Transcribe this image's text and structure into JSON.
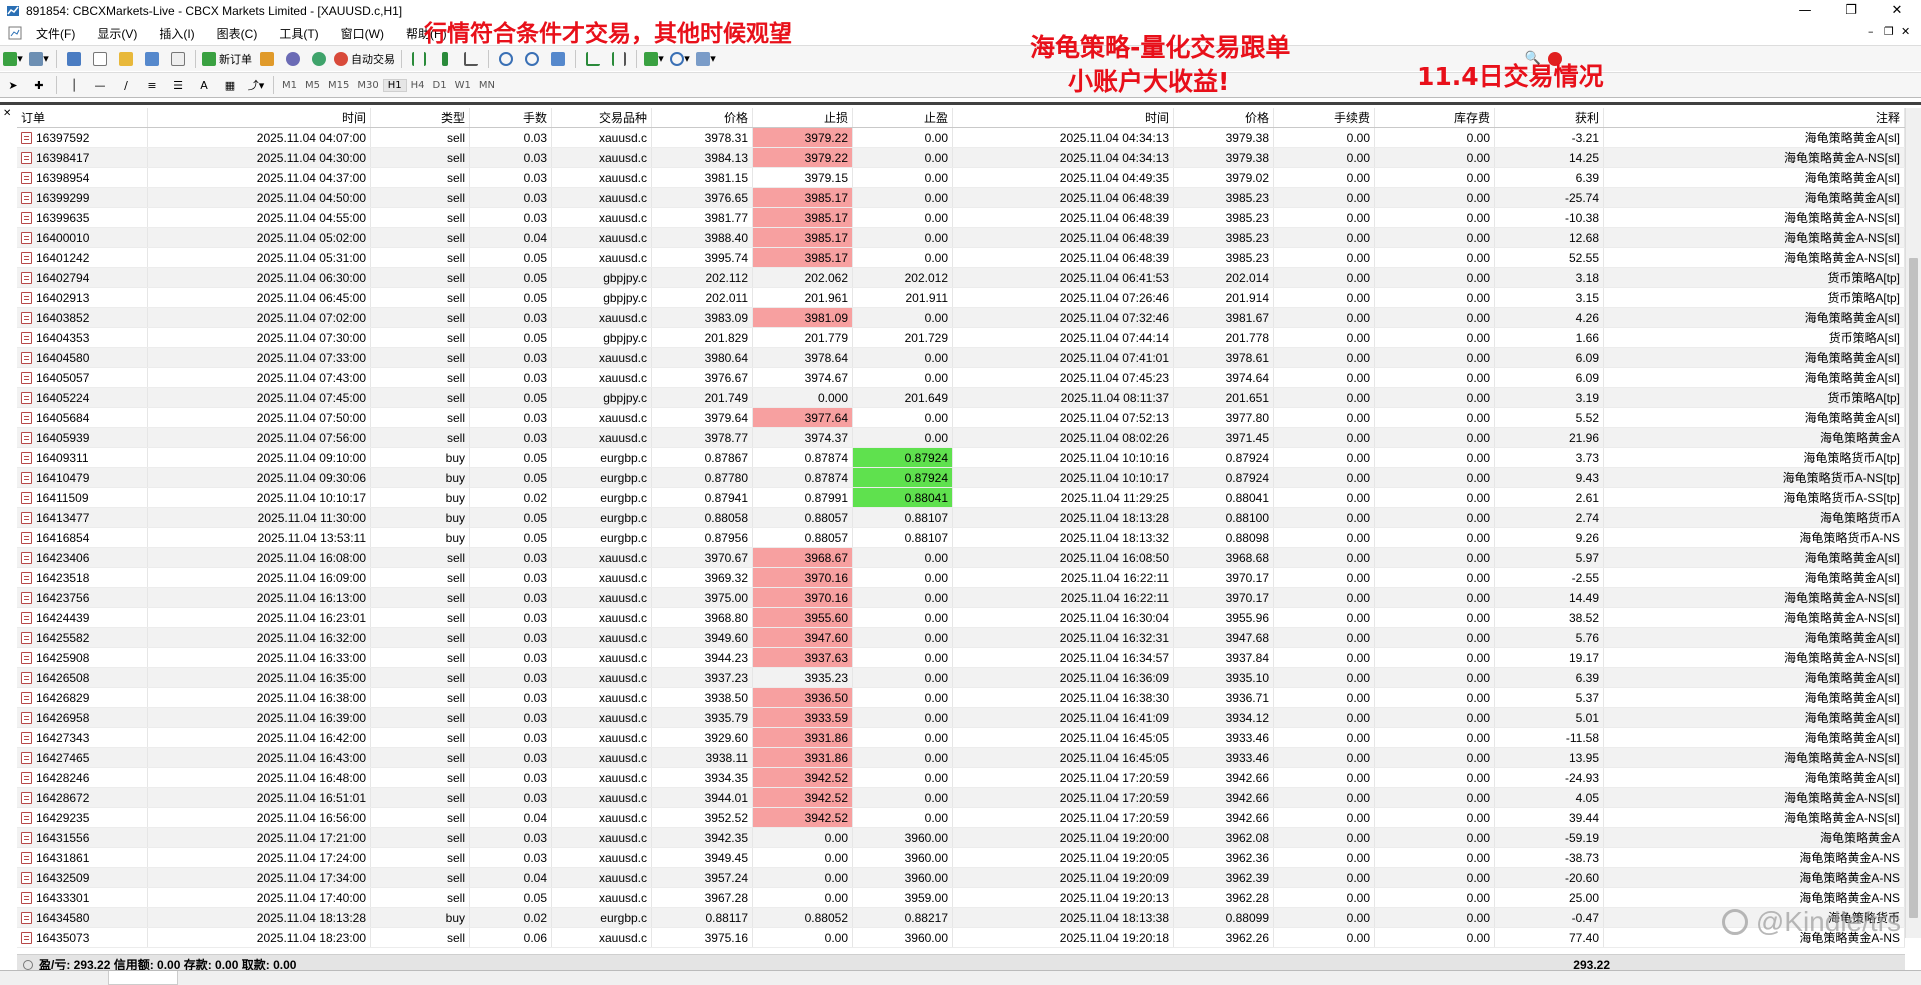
{
  "window": {
    "title": "891854: CBCXMarkets-Live - CBCX Markets Limited - [XAUUSD.c,H1]"
  },
  "menu": [
    "文件(F)",
    "显示(V)",
    "插入(I)",
    "图表(C)",
    "工具(T)",
    "窗口(W)",
    "帮助(H)"
  ],
  "toolbar": {
    "new_order": "新订单",
    "autotrade": "自动交易",
    "timeframes": [
      "M1",
      "M5",
      "M15",
      "M30",
      "H1",
      "H4",
      "D1",
      "W1",
      "MN"
    ],
    "active_timeframe": "H1"
  },
  "overlays": {
    "note1": "行情符合条件才交易，其他时候观望",
    "note2_line1": "海龟策略-量化交易跟单",
    "note2_line2": "小账户大收益!",
    "note3": "11.4日交易情况"
  },
  "table": {
    "columns": [
      "订单",
      "时间",
      "类型",
      "手数",
      "交易品种",
      "价格",
      "止损",
      "止盈",
      "时间",
      "价格",
      "手续费",
      "库存费",
      "获利",
      "注释"
    ],
    "rows": [
      {
        "order": "16397592",
        "open_time": "2025.11.04 04:07:00",
        "type": "sell",
        "lots": "0.03",
        "symbol": "xauusd.c",
        "open_price": "3978.31",
        "sl": "3979.22",
        "tp": "0.00",
        "close_time": "2025.11.04 04:34:13",
        "close_price": "3979.38",
        "commission": "0.00",
        "swap": "0.00",
        "profit": "-3.21",
        "comment": "海龟策略黄金A[sl]",
        "hl": "sl"
      },
      {
        "order": "16398417",
        "open_time": "2025.11.04 04:30:00",
        "type": "sell",
        "lots": "0.03",
        "symbol": "xauusd.c",
        "open_price": "3984.13",
        "sl": "3979.22",
        "tp": "0.00",
        "close_time": "2025.11.04 04:34:13",
        "close_price": "3979.38",
        "commission": "0.00",
        "swap": "0.00",
        "profit": "14.25",
        "comment": "海龟策略黄金A-NS[sl]",
        "hl": "sl"
      },
      {
        "order": "16398954",
        "open_time": "2025.11.04 04:37:00",
        "type": "sell",
        "lots": "0.03",
        "symbol": "xauusd.c",
        "open_price": "3981.15",
        "sl": "3979.15",
        "tp": "0.00",
        "close_time": "2025.11.04 04:49:35",
        "close_price": "3979.02",
        "commission": "0.00",
        "swap": "0.00",
        "profit": "6.39",
        "comment": "海龟策略黄金A[sl]",
        "hl": ""
      },
      {
        "order": "16399299",
        "open_time": "2025.11.04 04:50:00",
        "type": "sell",
        "lots": "0.03",
        "symbol": "xauusd.c",
        "open_price": "3976.65",
        "sl": "3985.17",
        "tp": "0.00",
        "close_time": "2025.11.04 06:48:39",
        "close_price": "3985.23",
        "commission": "0.00",
        "swap": "0.00",
        "profit": "-25.74",
        "comment": "海龟策略黄金A[sl]",
        "hl": "sl"
      },
      {
        "order": "16399635",
        "open_time": "2025.11.04 04:55:00",
        "type": "sell",
        "lots": "0.03",
        "symbol": "xauusd.c",
        "open_price": "3981.77",
        "sl": "3985.17",
        "tp": "0.00",
        "close_time": "2025.11.04 06:48:39",
        "close_price": "3985.23",
        "commission": "0.00",
        "swap": "0.00",
        "profit": "-10.38",
        "comment": "海龟策略黄金A-NS[sl]",
        "hl": "sl"
      },
      {
        "order": "16400010",
        "open_time": "2025.11.04 05:02:00",
        "type": "sell",
        "lots": "0.04",
        "symbol": "xauusd.c",
        "open_price": "3988.40",
        "sl": "3985.17",
        "tp": "0.00",
        "close_time": "2025.11.04 06:48:39",
        "close_price": "3985.23",
        "commission": "0.00",
        "swap": "0.00",
        "profit": "12.68",
        "comment": "海龟策略黄金A-NS[sl]",
        "hl": "sl"
      },
      {
        "order": "16401242",
        "open_time": "2025.11.04 05:31:00",
        "type": "sell",
        "lots": "0.05",
        "symbol": "xauusd.c",
        "open_price": "3995.74",
        "sl": "3985.17",
        "tp": "0.00",
        "close_time": "2025.11.04 06:48:39",
        "close_price": "3985.23",
        "commission": "0.00",
        "swap": "0.00",
        "profit": "52.55",
        "comment": "海龟策略黄金A-NS[sl]",
        "hl": "sl"
      },
      {
        "order": "16402794",
        "open_time": "2025.11.04 06:30:00",
        "type": "sell",
        "lots": "0.05",
        "symbol": "gbpjpy.c",
        "open_price": "202.112",
        "sl": "202.062",
        "tp": "202.012",
        "close_time": "2025.11.04 06:41:53",
        "close_price": "202.014",
        "commission": "0.00",
        "swap": "0.00",
        "profit": "3.18",
        "comment": "货币策略A[tp]",
        "hl": ""
      },
      {
        "order": "16402913",
        "open_time": "2025.11.04 06:45:00",
        "type": "sell",
        "lots": "0.05",
        "symbol": "gbpjpy.c",
        "open_price": "202.011",
        "sl": "201.961",
        "tp": "201.911",
        "close_time": "2025.11.04 07:26:46",
        "close_price": "201.914",
        "commission": "0.00",
        "swap": "0.00",
        "profit": "3.15",
        "comment": "货币策略A[tp]",
        "hl": ""
      },
      {
        "order": "16403852",
        "open_time": "2025.11.04 07:02:00",
        "type": "sell",
        "lots": "0.03",
        "symbol": "xauusd.c",
        "open_price": "3983.09",
        "sl": "3981.09",
        "tp": "0.00",
        "close_time": "2025.11.04 07:32:46",
        "close_price": "3981.67",
        "commission": "0.00",
        "swap": "0.00",
        "profit": "4.26",
        "comment": "海龟策略黄金A[sl]",
        "hl": "sl"
      },
      {
        "order": "16404353",
        "open_time": "2025.11.04 07:30:00",
        "type": "sell",
        "lots": "0.05",
        "symbol": "gbpjpy.c",
        "open_price": "201.829",
        "sl": "201.779",
        "tp": "201.729",
        "close_time": "2025.11.04 07:44:14",
        "close_price": "201.778",
        "commission": "0.00",
        "swap": "0.00",
        "profit": "1.66",
        "comment": "货币策略A[sl]",
        "hl": ""
      },
      {
        "order": "16404580",
        "open_time": "2025.11.04 07:33:00",
        "type": "sell",
        "lots": "0.03",
        "symbol": "xauusd.c",
        "open_price": "3980.64",
        "sl": "3978.64",
        "tp": "0.00",
        "close_time": "2025.11.04 07:41:01",
        "close_price": "3978.61",
        "commission": "0.00",
        "swap": "0.00",
        "profit": "6.09",
        "comment": "海龟策略黄金A[sl]",
        "hl": ""
      },
      {
        "order": "16405057",
        "open_time": "2025.11.04 07:43:00",
        "type": "sell",
        "lots": "0.03",
        "symbol": "xauusd.c",
        "open_price": "3976.67",
        "sl": "3974.67",
        "tp": "0.00",
        "close_time": "2025.11.04 07:45:23",
        "close_price": "3974.64",
        "commission": "0.00",
        "swap": "0.00",
        "profit": "6.09",
        "comment": "海龟策略黄金A[sl]",
        "hl": ""
      },
      {
        "order": "16405224",
        "open_time": "2025.11.04 07:45:00",
        "type": "sell",
        "lots": "0.05",
        "symbol": "gbpjpy.c",
        "open_price": "201.749",
        "sl": "0.000",
        "tp": "201.649",
        "close_time": "2025.11.04 08:11:37",
        "close_price": "201.651",
        "commission": "0.00",
        "swap": "0.00",
        "profit": "3.19",
        "comment": "货币策略A[tp]",
        "hl": ""
      },
      {
        "order": "16405684",
        "open_time": "2025.11.04 07:50:00",
        "type": "sell",
        "lots": "0.03",
        "symbol": "xauusd.c",
        "open_price": "3979.64",
        "sl": "3977.64",
        "tp": "0.00",
        "close_time": "2025.11.04 07:52:13",
        "close_price": "3977.80",
        "commission": "0.00",
        "swap": "0.00",
        "profit": "5.52",
        "comment": "海龟策略黄金A[sl]",
        "hl": "sl"
      },
      {
        "order": "16405939",
        "open_time": "2025.11.04 07:56:00",
        "type": "sell",
        "lots": "0.03",
        "symbol": "xauusd.c",
        "open_price": "3978.77",
        "sl": "3974.37",
        "tp": "0.00",
        "close_time": "2025.11.04 08:02:26",
        "close_price": "3971.45",
        "commission": "0.00",
        "swap": "0.00",
        "profit": "21.96",
        "comment": "海龟策略黄金A",
        "hl": ""
      },
      {
        "order": "16409311",
        "open_time": "2025.11.04 09:10:00",
        "type": "buy",
        "lots": "0.05",
        "symbol": "eurgbp.c",
        "open_price": "0.87867",
        "sl": "0.87874",
        "tp": "0.87924",
        "close_time": "2025.11.04 10:10:16",
        "close_price": "0.87924",
        "commission": "0.00",
        "swap": "0.00",
        "profit": "3.73",
        "comment": "海龟策略货币A[tp]",
        "hl": "tp"
      },
      {
        "order": "16410479",
        "open_time": "2025.11.04 09:30:06",
        "type": "buy",
        "lots": "0.05",
        "symbol": "eurgbp.c",
        "open_price": "0.87780",
        "sl": "0.87874",
        "tp": "0.87924",
        "close_time": "2025.11.04 10:10:17",
        "close_price": "0.87924",
        "commission": "0.00",
        "swap": "0.00",
        "profit": "9.43",
        "comment": "海龟策略货币A-NS[tp]",
        "hl": "tp"
      },
      {
        "order": "16411509",
        "open_time": "2025.11.04 10:10:17",
        "type": "buy",
        "lots": "0.02",
        "symbol": "eurgbp.c",
        "open_price": "0.87941",
        "sl": "0.87991",
        "tp": "0.88041",
        "close_time": "2025.11.04 11:29:25",
        "close_price": "0.88041",
        "commission": "0.00",
        "swap": "0.00",
        "profit": "2.61",
        "comment": "海龟策略货币A-SS[tp]",
        "hl": "tp"
      },
      {
        "order": "16413477",
        "open_time": "2025.11.04 11:30:00",
        "type": "buy",
        "lots": "0.05",
        "symbol": "eurgbp.c",
        "open_price": "0.88058",
        "sl": "0.88057",
        "tp": "0.88107",
        "close_time": "2025.11.04 18:13:28",
        "close_price": "0.88100",
        "commission": "0.00",
        "swap": "0.00",
        "profit": "2.74",
        "comment": "海龟策略货币A",
        "hl": ""
      },
      {
        "order": "16416854",
        "open_time": "2025.11.04 13:53:11",
        "type": "buy",
        "lots": "0.05",
        "symbol": "eurgbp.c",
        "open_price": "0.87956",
        "sl": "0.88057",
        "tp": "0.88107",
        "close_time": "2025.11.04 18:13:32",
        "close_price": "0.88098",
        "commission": "0.00",
        "swap": "0.00",
        "profit": "9.26",
        "comment": "海龟策略货币A-NS",
        "hl": ""
      },
      {
        "order": "16423406",
        "open_time": "2025.11.04 16:08:00",
        "type": "sell",
        "lots": "0.03",
        "symbol": "xauusd.c",
        "open_price": "3970.67",
        "sl": "3968.67",
        "tp": "0.00",
        "close_time": "2025.11.04 16:08:50",
        "close_price": "3968.68",
        "commission": "0.00",
        "swap": "0.00",
        "profit": "5.97",
        "comment": "海龟策略黄金A[sl]",
        "hl": "sl"
      },
      {
        "order": "16423518",
        "open_time": "2025.11.04 16:09:00",
        "type": "sell",
        "lots": "0.03",
        "symbol": "xauusd.c",
        "open_price": "3969.32",
        "sl": "3970.16",
        "tp": "0.00",
        "close_time": "2025.11.04 16:22:11",
        "close_price": "3970.17",
        "commission": "0.00",
        "swap": "0.00",
        "profit": "-2.55",
        "comment": "海龟策略黄金A[sl]",
        "hl": "sl"
      },
      {
        "order": "16423756",
        "open_time": "2025.11.04 16:13:00",
        "type": "sell",
        "lots": "0.03",
        "symbol": "xauusd.c",
        "open_price": "3975.00",
        "sl": "3970.16",
        "tp": "0.00",
        "close_time": "2025.11.04 16:22:11",
        "close_price": "3970.17",
        "commission": "0.00",
        "swap": "0.00",
        "profit": "14.49",
        "comment": "海龟策略黄金A-NS[sl]",
        "hl": "sl"
      },
      {
        "order": "16424439",
        "open_time": "2025.11.04 16:23:01",
        "type": "sell",
        "lots": "0.03",
        "symbol": "xauusd.c",
        "open_price": "3968.80",
        "sl": "3955.60",
        "tp": "0.00",
        "close_time": "2025.11.04 16:30:04",
        "close_price": "3955.96",
        "commission": "0.00",
        "swap": "0.00",
        "profit": "38.52",
        "comment": "海龟策略黄金A-NS[sl]",
        "hl": "sl"
      },
      {
        "order": "16425582",
        "open_time": "2025.11.04 16:32:00",
        "type": "sell",
        "lots": "0.03",
        "symbol": "xauusd.c",
        "open_price": "3949.60",
        "sl": "3947.60",
        "tp": "0.00",
        "close_time": "2025.11.04 16:32:31",
        "close_price": "3947.68",
        "commission": "0.00",
        "swap": "0.00",
        "profit": "5.76",
        "comment": "海龟策略黄金A[sl]",
        "hl": "sl"
      },
      {
        "order": "16425908",
        "open_time": "2025.11.04 16:33:00",
        "type": "sell",
        "lots": "0.03",
        "symbol": "xauusd.c",
        "open_price": "3944.23",
        "sl": "3937.63",
        "tp": "0.00",
        "close_time": "2025.11.04 16:34:57",
        "close_price": "3937.84",
        "commission": "0.00",
        "swap": "0.00",
        "profit": "19.17",
        "comment": "海龟策略黄金A-NS[sl]",
        "hl": "sl"
      },
      {
        "order": "16426508",
        "open_time": "2025.11.04 16:35:00",
        "type": "sell",
        "lots": "0.03",
        "symbol": "xauusd.c",
        "open_price": "3937.23",
        "sl": "3935.23",
        "tp": "0.00",
        "close_time": "2025.11.04 16:36:09",
        "close_price": "3935.10",
        "commission": "0.00",
        "swap": "0.00",
        "profit": "6.39",
        "comment": "海龟策略黄金A[sl]",
        "hl": ""
      },
      {
        "order": "16426829",
        "open_time": "2025.11.04 16:38:00",
        "type": "sell",
        "lots": "0.03",
        "symbol": "xauusd.c",
        "open_price": "3938.50",
        "sl": "3936.50",
        "tp": "0.00",
        "close_time": "2025.11.04 16:38:30",
        "close_price": "3936.71",
        "commission": "0.00",
        "swap": "0.00",
        "profit": "5.37",
        "comment": "海龟策略黄金A[sl]",
        "hl": "sl"
      },
      {
        "order": "16426958",
        "open_time": "2025.11.04 16:39:00",
        "type": "sell",
        "lots": "0.03",
        "symbol": "xauusd.c",
        "open_price": "3935.79",
        "sl": "3933.59",
        "tp": "0.00",
        "close_time": "2025.11.04 16:41:09",
        "close_price": "3934.12",
        "commission": "0.00",
        "swap": "0.00",
        "profit": "5.01",
        "comment": "海龟策略黄金A[sl]",
        "hl": "sl"
      },
      {
        "order": "16427343",
        "open_time": "2025.11.04 16:42:00",
        "type": "sell",
        "lots": "0.03",
        "symbol": "xauusd.c",
        "open_price": "3929.60",
        "sl": "3931.86",
        "tp": "0.00",
        "close_time": "2025.11.04 16:45:05",
        "close_price": "3933.46",
        "commission": "0.00",
        "swap": "0.00",
        "profit": "-11.58",
        "comment": "海龟策略黄金A[sl]",
        "hl": "sl"
      },
      {
        "order": "16427465",
        "open_time": "2025.11.04 16:43:00",
        "type": "sell",
        "lots": "0.03",
        "symbol": "xauusd.c",
        "open_price": "3938.11",
        "sl": "3931.86",
        "tp": "0.00",
        "close_time": "2025.11.04 16:45:05",
        "close_price": "3933.46",
        "commission": "0.00",
        "swap": "0.00",
        "profit": "13.95",
        "comment": "海龟策略黄金A-NS[sl]",
        "hl": "sl"
      },
      {
        "order": "16428246",
        "open_time": "2025.11.04 16:48:00",
        "type": "sell",
        "lots": "0.03",
        "symbol": "xauusd.c",
        "open_price": "3934.35",
        "sl": "3942.52",
        "tp": "0.00",
        "close_time": "2025.11.04 17:20:59",
        "close_price": "3942.66",
        "commission": "0.00",
        "swap": "0.00",
        "profit": "-24.93",
        "comment": "海龟策略黄金A[sl]",
        "hl": "sl"
      },
      {
        "order": "16428672",
        "open_time": "2025.11.04 16:51:01",
        "type": "sell",
        "lots": "0.03",
        "symbol": "xauusd.c",
        "open_price": "3944.01",
        "sl": "3942.52",
        "tp": "0.00",
        "close_time": "2025.11.04 17:20:59",
        "close_price": "3942.66",
        "commission": "0.00",
        "swap": "0.00",
        "profit": "4.05",
        "comment": "海龟策略黄金A-NS[sl]",
        "hl": "sl"
      },
      {
        "order": "16429235",
        "open_time": "2025.11.04 16:56:00",
        "type": "sell",
        "lots": "0.04",
        "symbol": "xauusd.c",
        "open_price": "3952.52",
        "sl": "3942.52",
        "tp": "0.00",
        "close_time": "2025.11.04 17:20:59",
        "close_price": "3942.66",
        "commission": "0.00",
        "swap": "0.00",
        "profit": "39.44",
        "comment": "海龟策略黄金A-NS[sl]",
        "hl": "sl"
      },
      {
        "order": "16431556",
        "open_time": "2025.11.04 17:21:00",
        "type": "sell",
        "lots": "0.03",
        "symbol": "xauusd.c",
        "open_price": "3942.35",
        "sl": "0.00",
        "tp": "3960.00",
        "close_time": "2025.11.04 19:20:00",
        "close_price": "3962.08",
        "commission": "0.00",
        "swap": "0.00",
        "profit": "-59.19",
        "comment": "海龟策略黄金A",
        "hl": ""
      },
      {
        "order": "16431861",
        "open_time": "2025.11.04 17:24:00",
        "type": "sell",
        "lots": "0.03",
        "symbol": "xauusd.c",
        "open_price": "3949.45",
        "sl": "0.00",
        "tp": "3960.00",
        "close_time": "2025.11.04 19:20:05",
        "close_price": "3962.36",
        "commission": "0.00",
        "swap": "0.00",
        "profit": "-38.73",
        "comment": "海龟策略黄金A-NS",
        "hl": ""
      },
      {
        "order": "16432509",
        "open_time": "2025.11.04 17:34:00",
        "type": "sell",
        "lots": "0.04",
        "symbol": "xauusd.c",
        "open_price": "3957.24",
        "sl": "0.00",
        "tp": "3960.00",
        "close_time": "2025.11.04 19:20:09",
        "close_price": "3962.39",
        "commission": "0.00",
        "swap": "0.00",
        "profit": "-20.60",
        "comment": "海龟策略黄金A-NS",
        "hl": ""
      },
      {
        "order": "16433301",
        "open_time": "2025.11.04 17:40:00",
        "type": "sell",
        "lots": "0.05",
        "symbol": "xauusd.c",
        "open_price": "3967.28",
        "sl": "0.00",
        "tp": "3959.00",
        "close_time": "2025.11.04 19:20:13",
        "close_price": "3962.28",
        "commission": "0.00",
        "swap": "0.00",
        "profit": "25.00",
        "comment": "海龟策略黄金A-NS",
        "hl": ""
      },
      {
        "order": "16434580",
        "open_time": "2025.11.04 18:13:28",
        "type": "buy",
        "lots": "0.02",
        "symbol": "eurgbp.c",
        "open_price": "0.88117",
        "sl": "0.88052",
        "tp": "0.88217",
        "close_time": "2025.11.04 18:13:38",
        "close_price": "0.88099",
        "commission": "0.00",
        "swap": "0.00",
        "profit": "-0.47",
        "comment": "海龟策略货币",
        "hl": ""
      },
      {
        "order": "16435073",
        "open_time": "2025.11.04 18:23:00",
        "type": "sell",
        "lots": "0.06",
        "symbol": "xauusd.c",
        "open_price": "3975.16",
        "sl": "0.00",
        "tp": "3960.00",
        "close_time": "2025.11.04 19:20:18",
        "close_price": "3962.26",
        "commission": "0.00",
        "swap": "0.00",
        "profit": "77.40",
        "comment": "海龟策略黄金A-NS",
        "hl": ""
      }
    ]
  },
  "summary": {
    "text": "盈/亏: 293.22  信用额: 0.00  存款: 0.00  取款: 0.00",
    "total": "293.22"
  },
  "watermark": {
    "text": "@Kindle/trs"
  }
}
